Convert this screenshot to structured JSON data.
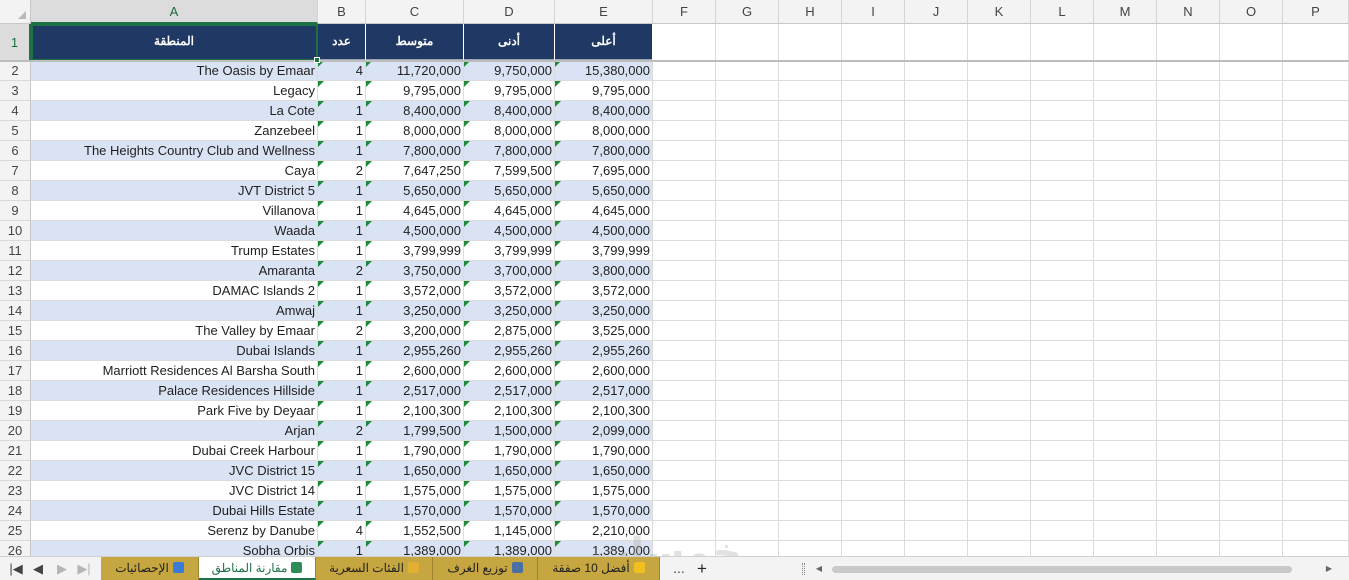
{
  "columns": [
    "A",
    "B",
    "C",
    "D",
    "E",
    "F",
    "G",
    "H",
    "I",
    "J",
    "K",
    "L",
    "M",
    "N",
    "O",
    "P"
  ],
  "selected_column": "A",
  "selected_row": "1",
  "headers": {
    "region": "المنطقة",
    "count": "عدد",
    "average": "متوسط",
    "min": "أدنى",
    "max": "أعلى"
  },
  "rows": [
    {
      "n": "2",
      "region": "The Oasis by Emaar",
      "count": "4",
      "average": "11,720,000",
      "min": "9,750,000",
      "max": "15,380,000"
    },
    {
      "n": "3",
      "region": "Legacy",
      "count": "1",
      "average": "9,795,000",
      "min": "9,795,000",
      "max": "9,795,000"
    },
    {
      "n": "4",
      "region": "La Cote",
      "count": "1",
      "average": "8,400,000",
      "min": "8,400,000",
      "max": "8,400,000"
    },
    {
      "n": "5",
      "region": "Zanzebeel",
      "count": "1",
      "average": "8,000,000",
      "min": "8,000,000",
      "max": "8,000,000"
    },
    {
      "n": "6",
      "region": "The Heights Country Club and Wellness",
      "count": "1",
      "average": "7,800,000",
      "min": "7,800,000",
      "max": "7,800,000"
    },
    {
      "n": "7",
      "region": "Caya",
      "count": "2",
      "average": "7,647,250",
      "min": "7,599,500",
      "max": "7,695,000"
    },
    {
      "n": "8",
      "region": "JVT District 5",
      "count": "1",
      "average": "5,650,000",
      "min": "5,650,000",
      "max": "5,650,000"
    },
    {
      "n": "9",
      "region": "Villanova",
      "count": "1",
      "average": "4,645,000",
      "min": "4,645,000",
      "max": "4,645,000"
    },
    {
      "n": "10",
      "region": "Waada",
      "count": "1",
      "average": "4,500,000",
      "min": "4,500,000",
      "max": "4,500,000"
    },
    {
      "n": "11",
      "region": "Trump Estates",
      "count": "1",
      "average": "3,799,999",
      "min": "3,799,999",
      "max": "3,799,999"
    },
    {
      "n": "12",
      "region": "Amaranta",
      "count": "2",
      "average": "3,750,000",
      "min": "3,700,000",
      "max": "3,800,000"
    },
    {
      "n": "13",
      "region": "DAMAC Islands 2",
      "count": "1",
      "average": "3,572,000",
      "min": "3,572,000",
      "max": "3,572,000"
    },
    {
      "n": "14",
      "region": "Amwaj",
      "count": "1",
      "average": "3,250,000",
      "min": "3,250,000",
      "max": "3,250,000"
    },
    {
      "n": "15",
      "region": "The Valley by Emaar",
      "count": "2",
      "average": "3,200,000",
      "min": "2,875,000",
      "max": "3,525,000"
    },
    {
      "n": "16",
      "region": "Dubai Islands",
      "count": "1",
      "average": "2,955,260",
      "min": "2,955,260",
      "max": "2,955,260"
    },
    {
      "n": "17",
      "region": "Marriott Residences Al Barsha South",
      "count": "1",
      "average": "2,600,000",
      "min": "2,600,000",
      "max": "2,600,000"
    },
    {
      "n": "18",
      "region": "Palace Residences Hillside",
      "count": "1",
      "average": "2,517,000",
      "min": "2,517,000",
      "max": "2,517,000"
    },
    {
      "n": "19",
      "region": "Park Five by Deyaar",
      "count": "1",
      "average": "2,100,300",
      "min": "2,100,300",
      "max": "2,100,300"
    },
    {
      "n": "20",
      "region": "Arjan",
      "count": "2",
      "average": "1,799,500",
      "min": "1,500,000",
      "max": "2,099,000"
    },
    {
      "n": "21",
      "region": "Dubai Creek Harbour",
      "count": "1",
      "average": "1,790,000",
      "min": "1,790,000",
      "max": "1,790,000"
    },
    {
      "n": "22",
      "region": "JVC District 15",
      "count": "1",
      "average": "1,650,000",
      "min": "1,650,000",
      "max": "1,650,000"
    },
    {
      "n": "23",
      "region": "JVC District 14",
      "count": "1",
      "average": "1,575,000",
      "min": "1,575,000",
      "max": "1,575,000"
    },
    {
      "n": "24",
      "region": "Dubai Hills Estate",
      "count": "1",
      "average": "1,570,000",
      "min": "1,570,000",
      "max": "1,570,000"
    },
    {
      "n": "25",
      "region": "Serenz by Danube",
      "count": "4",
      "average": "1,552,500",
      "min": "1,145,000",
      "max": "2,210,000"
    },
    {
      "n": "26",
      "region": "Sobha Orbis",
      "count": "1",
      "average": "1,389,000",
      "min": "1,389,000",
      "max": "1,389,000"
    }
  ],
  "colors": {
    "header_bg": "#1f3864",
    "band_row": "#dae3f3",
    "tab_bg": "#c6a640",
    "accent": "#1e7145"
  },
  "tabs": [
    {
      "label": "الإحصائيات",
      "icon": "bar-chart-icon",
      "active": false
    },
    {
      "label": "مقارنة المناطق",
      "icon": "map-icon",
      "active": true
    },
    {
      "label": "الفئات السعرية",
      "icon": "tag-icon",
      "active": false
    },
    {
      "label": "توزيع الغرف",
      "icon": "bed-icon",
      "active": false
    },
    {
      "label": "أفضل 10 صفقة",
      "icon": "star-icon",
      "active": false
    }
  ],
  "tabbar": {
    "first": "|◀",
    "prev": "◀",
    "next": "▶",
    "last": "▶|",
    "more": "...",
    "add": "+"
  },
  "watermark": "خمسات"
}
